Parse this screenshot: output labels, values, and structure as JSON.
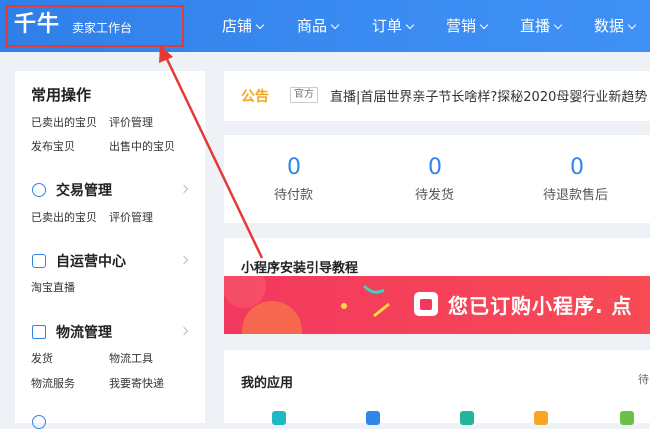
{
  "header": {
    "logo_main": "千牛",
    "logo_sub": "卖家工作台",
    "nav": [
      "店铺",
      "商品",
      "订单",
      "营销",
      "直播",
      "数据"
    ]
  },
  "sidebar": {
    "common_title": "常用操作",
    "common_links": [
      "已卖出的宝贝",
      "评价管理",
      "发布宝贝",
      "出售中的宝贝"
    ],
    "sections": [
      {
        "title": "交易管理",
        "icon": "yen-icon",
        "links": [
          "已卖出的宝贝",
          "评价管理"
        ]
      },
      {
        "title": "自运营中心",
        "icon": "chat-icon",
        "links": [
          "淘宝直播"
        ]
      },
      {
        "title": "物流管理",
        "icon": "truck-icon",
        "links": [
          "发货",
          "物流工具",
          "物流服务",
          "我要寄快递"
        ]
      }
    ]
  },
  "notice": {
    "label": "公告",
    "tag": "官方",
    "text": "直播|首届世界亲子节长啥样?探秘2020母婴行业新趋势"
  },
  "stats": [
    {
      "value": "0",
      "label": "待付款"
    },
    {
      "value": "0",
      "label": "待发货"
    },
    {
      "value": "0",
      "label": "待退款售后"
    }
  ],
  "mini_program": {
    "title": "小程序安装引导教程",
    "banner_text": "您已订购小程序. 点"
  },
  "apps": {
    "title": "我的应用",
    "right_text": "待"
  },
  "colors": {
    "header_blue": "#3a8af0",
    "accent_blue": "#2f86e8",
    "notice_orange": "#f5a623",
    "banner_red": "#f2385e",
    "annotation_red": "#e53935"
  }
}
